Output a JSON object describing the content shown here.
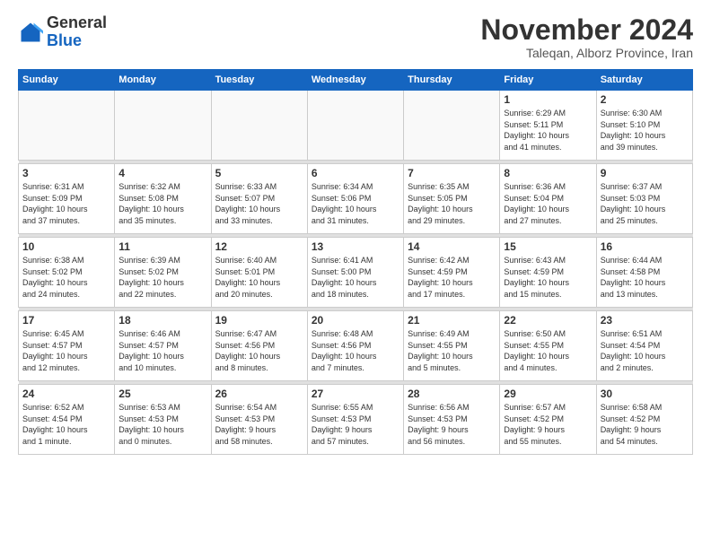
{
  "logo": {
    "general": "General",
    "blue": "Blue"
  },
  "header": {
    "month_year": "November 2024",
    "location": "Taleqan, Alborz Province, Iran"
  },
  "weekdays": [
    "Sunday",
    "Monday",
    "Tuesday",
    "Wednesday",
    "Thursday",
    "Friday",
    "Saturday"
  ],
  "weeks": [
    [
      {
        "day": "",
        "info": ""
      },
      {
        "day": "",
        "info": ""
      },
      {
        "day": "",
        "info": ""
      },
      {
        "day": "",
        "info": ""
      },
      {
        "day": "",
        "info": ""
      },
      {
        "day": "1",
        "info": "Sunrise: 6:29 AM\nSunset: 5:11 PM\nDaylight: 10 hours\nand 41 minutes."
      },
      {
        "day": "2",
        "info": "Sunrise: 6:30 AM\nSunset: 5:10 PM\nDaylight: 10 hours\nand 39 minutes."
      }
    ],
    [
      {
        "day": "3",
        "info": "Sunrise: 6:31 AM\nSunset: 5:09 PM\nDaylight: 10 hours\nand 37 minutes."
      },
      {
        "day": "4",
        "info": "Sunrise: 6:32 AM\nSunset: 5:08 PM\nDaylight: 10 hours\nand 35 minutes."
      },
      {
        "day": "5",
        "info": "Sunrise: 6:33 AM\nSunset: 5:07 PM\nDaylight: 10 hours\nand 33 minutes."
      },
      {
        "day": "6",
        "info": "Sunrise: 6:34 AM\nSunset: 5:06 PM\nDaylight: 10 hours\nand 31 minutes."
      },
      {
        "day": "7",
        "info": "Sunrise: 6:35 AM\nSunset: 5:05 PM\nDaylight: 10 hours\nand 29 minutes."
      },
      {
        "day": "8",
        "info": "Sunrise: 6:36 AM\nSunset: 5:04 PM\nDaylight: 10 hours\nand 27 minutes."
      },
      {
        "day": "9",
        "info": "Sunrise: 6:37 AM\nSunset: 5:03 PM\nDaylight: 10 hours\nand 25 minutes."
      }
    ],
    [
      {
        "day": "10",
        "info": "Sunrise: 6:38 AM\nSunset: 5:02 PM\nDaylight: 10 hours\nand 24 minutes."
      },
      {
        "day": "11",
        "info": "Sunrise: 6:39 AM\nSunset: 5:02 PM\nDaylight: 10 hours\nand 22 minutes."
      },
      {
        "day": "12",
        "info": "Sunrise: 6:40 AM\nSunset: 5:01 PM\nDaylight: 10 hours\nand 20 minutes."
      },
      {
        "day": "13",
        "info": "Sunrise: 6:41 AM\nSunset: 5:00 PM\nDaylight: 10 hours\nand 18 minutes."
      },
      {
        "day": "14",
        "info": "Sunrise: 6:42 AM\nSunset: 4:59 PM\nDaylight: 10 hours\nand 17 minutes."
      },
      {
        "day": "15",
        "info": "Sunrise: 6:43 AM\nSunset: 4:59 PM\nDaylight: 10 hours\nand 15 minutes."
      },
      {
        "day": "16",
        "info": "Sunrise: 6:44 AM\nSunset: 4:58 PM\nDaylight: 10 hours\nand 13 minutes."
      }
    ],
    [
      {
        "day": "17",
        "info": "Sunrise: 6:45 AM\nSunset: 4:57 PM\nDaylight: 10 hours\nand 12 minutes."
      },
      {
        "day": "18",
        "info": "Sunrise: 6:46 AM\nSunset: 4:57 PM\nDaylight: 10 hours\nand 10 minutes."
      },
      {
        "day": "19",
        "info": "Sunrise: 6:47 AM\nSunset: 4:56 PM\nDaylight: 10 hours\nand 8 minutes."
      },
      {
        "day": "20",
        "info": "Sunrise: 6:48 AM\nSunset: 4:56 PM\nDaylight: 10 hours\nand 7 minutes."
      },
      {
        "day": "21",
        "info": "Sunrise: 6:49 AM\nSunset: 4:55 PM\nDaylight: 10 hours\nand 5 minutes."
      },
      {
        "day": "22",
        "info": "Sunrise: 6:50 AM\nSunset: 4:55 PM\nDaylight: 10 hours\nand 4 minutes."
      },
      {
        "day": "23",
        "info": "Sunrise: 6:51 AM\nSunset: 4:54 PM\nDaylight: 10 hours\nand 2 minutes."
      }
    ],
    [
      {
        "day": "24",
        "info": "Sunrise: 6:52 AM\nSunset: 4:54 PM\nDaylight: 10 hours\nand 1 minute."
      },
      {
        "day": "25",
        "info": "Sunrise: 6:53 AM\nSunset: 4:53 PM\nDaylight: 10 hours\nand 0 minutes."
      },
      {
        "day": "26",
        "info": "Sunrise: 6:54 AM\nSunset: 4:53 PM\nDaylight: 9 hours\nand 58 minutes."
      },
      {
        "day": "27",
        "info": "Sunrise: 6:55 AM\nSunset: 4:53 PM\nDaylight: 9 hours\nand 57 minutes."
      },
      {
        "day": "28",
        "info": "Sunrise: 6:56 AM\nSunset: 4:53 PM\nDaylight: 9 hours\nand 56 minutes."
      },
      {
        "day": "29",
        "info": "Sunrise: 6:57 AM\nSunset: 4:52 PM\nDaylight: 9 hours\nand 55 minutes."
      },
      {
        "day": "30",
        "info": "Sunrise: 6:58 AM\nSunset: 4:52 PM\nDaylight: 9 hours\nand 54 minutes."
      }
    ]
  ]
}
